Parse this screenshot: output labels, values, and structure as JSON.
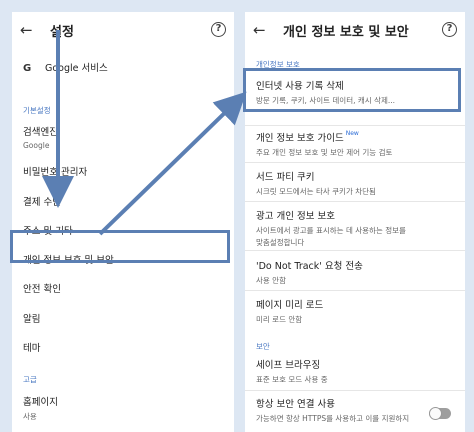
{
  "left": {
    "back_icon": "arrow-left-icon",
    "title": "설정",
    "help_icon": "help-circle-icon",
    "google_logo": "G",
    "google_services": "Google 서비스",
    "section_basic": "기본설정",
    "search_engine_label": "검색엔진",
    "search_engine_value": "Google",
    "password_manager": "비밀번호 관리자",
    "payment_methods": "결제 수단",
    "addresses": "주소 및 기타",
    "privacy_security": "개인 정보 보호 및 보안",
    "safety_check": "안전 확인",
    "notifications": "알림",
    "theme": "테마",
    "section_advanced": "고급",
    "homepage_label": "홈페이지",
    "homepage_value": "사용"
  },
  "right": {
    "back_icon": "arrow-left-icon",
    "title": "개인 정보 보호 및 보안",
    "help_icon": "help-circle-icon",
    "section_privacy": "개인정보 보호",
    "clear_browsing_label": "인터넷 사용 기록 삭제",
    "clear_browsing_sub": "방문 기록, 쿠키, 사이트 데이터, 캐시 삭제...",
    "privacy_guide_label": "개인 정보 보호 가이드",
    "privacy_guide_badge": "New",
    "privacy_guide_sub": "주요 개인 정보 보호 및 보안 제어 기능 검토",
    "third_party_label": "서드 파티 쿠키",
    "third_party_sub": "시크릿 모드에서는 타사 쿠키가 차단됨",
    "ad_privacy_label": "광고 개인 정보 보호",
    "ad_privacy_sub1": "사이트에서 광고를 표시하는 데 사용하는 정보를",
    "ad_privacy_sub2": "맞춤설정합니다",
    "dnt_label": "'Do Not Track' 요청 전송",
    "dnt_sub": "사용 안함",
    "preload_label": "페이지 미리 로드",
    "preload_sub": "미리 로드 안함",
    "section_security": "보안",
    "safe_browsing_label": "세이프 브라우징",
    "safe_browsing_sub": "표준 보호 모드 사용 중",
    "https_label": "항상 보안 연결 사용",
    "https_sub": "가능하면 항상 HTTPS를 사용하고 이를 지원하지",
    "https_toggle_on": false
  },
  "colors": {
    "background": "#dde7f3",
    "highlight": "#5b7fb3",
    "section_text": "#4a78c2"
  }
}
